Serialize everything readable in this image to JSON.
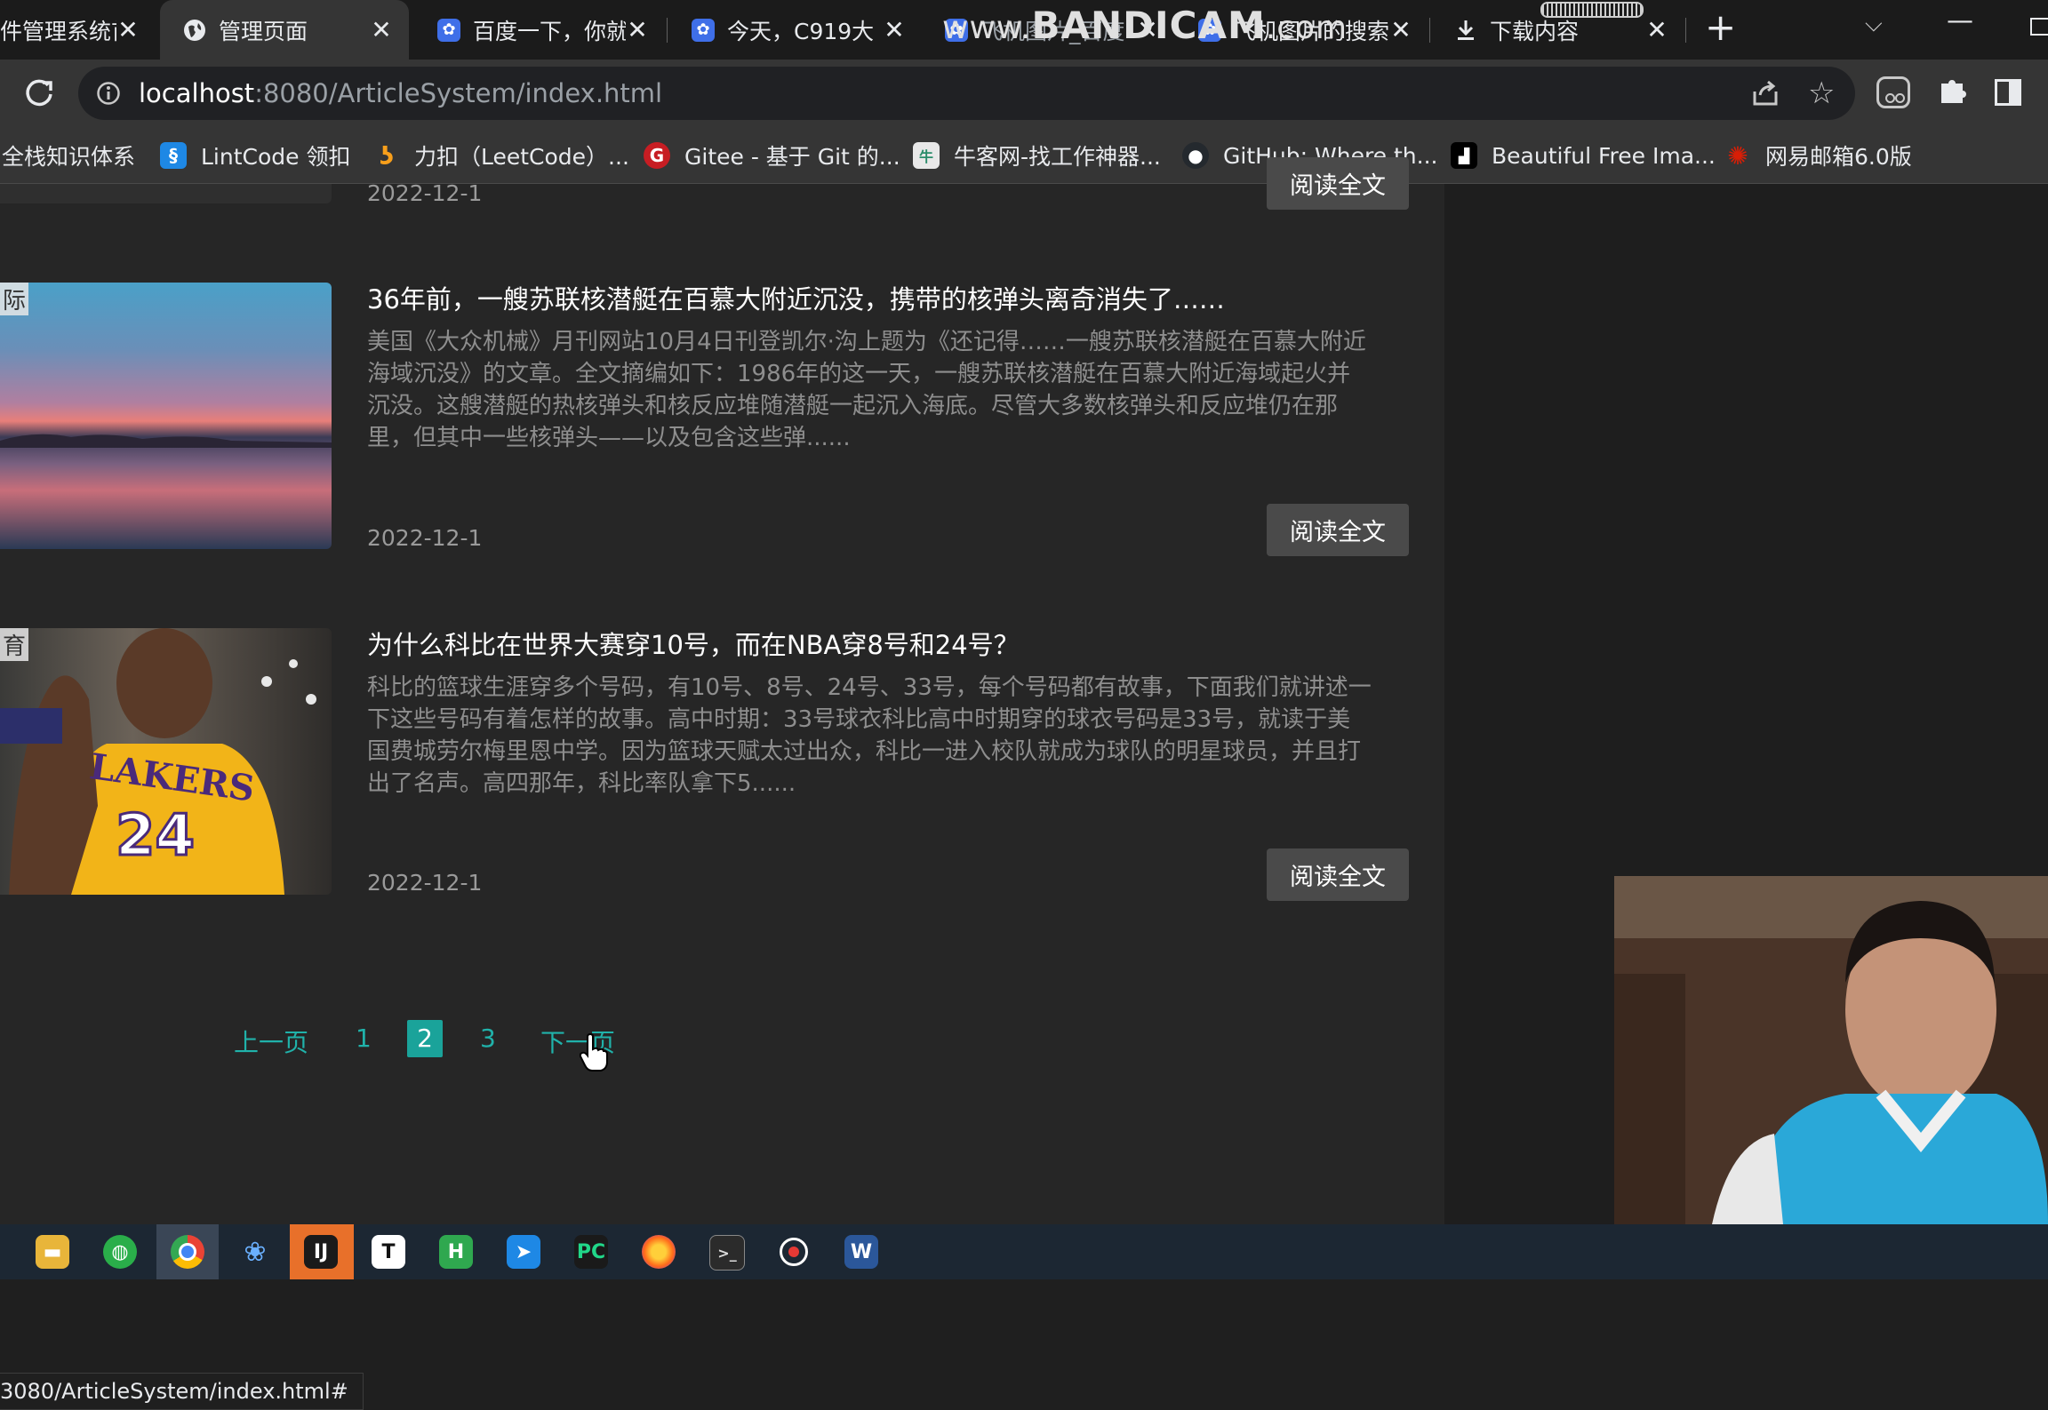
{
  "browser": {
    "tabs": [
      {
        "title": "件管理系统首",
        "favicon": "page-icon"
      },
      {
        "title": "管理页面",
        "favicon": "globe-icon"
      },
      {
        "title": "百度一下，你就",
        "favicon": "baidu-paw-icon"
      },
      {
        "title": "今天，C919大",
        "favicon": "baidu-paw-icon"
      },
      {
        "title": "飞机图片_百度",
        "favicon": "baidu-paw-icon"
      },
      {
        "title": "飞机图片的搜索",
        "favicon": "baidu-paw-icon"
      },
      {
        "title": "下载内容",
        "favicon": "download-icon"
      }
    ],
    "new_tab_label": "+",
    "url_host": "localhost",
    "url_rest": ":8080/ArticleSystem/index.html",
    "bookmarks": [
      {
        "label": "全栈知识体系",
        "icon": "bookmark-icon",
        "color": "#4a4a4a"
      },
      {
        "label": "LintCode 领扣",
        "icon": "lintcode-icon",
        "color": "#1e88e5"
      },
      {
        "label": "力扣（LeetCode）...",
        "icon": "leetcode-icon",
        "color": "#f89f1b"
      },
      {
        "label": "Gitee - 基于 Git 的...",
        "icon": "gitee-icon",
        "color": "#c71d23"
      },
      {
        "label": "牛客网-找工作神器...",
        "icon": "nowcoder-icon",
        "color": "#e8e8e8"
      },
      {
        "label": "GitHub: Where th...",
        "icon": "github-icon",
        "color": "#24292e"
      },
      {
        "label": "Beautiful Free Ima...",
        "icon": "unsplash-icon",
        "color": "#111111"
      },
      {
        "label": "网易邮箱6.0版",
        "icon": "netease-mail-icon",
        "color": "#d81e06"
      }
    ]
  },
  "watermark": {
    "brand": "BANDICAM",
    "prefix": "www.",
    "suffix": ".com"
  },
  "articles": [
    {
      "date": "2022-12-1",
      "button": "阅读全文"
    },
    {
      "category": "际",
      "title": "36年前，一艘苏联核潜艇在百慕大附近沉没，携带的核弹头离奇消失了……",
      "summary": "美国《大众机械》月刊网站10月4日刊登凯尔·沟上题为《还记得……一艘苏联核潜艇在百慕大附近海域沉没》的文章。全文摘编如下：1986年的这一天，一艘苏联核潜艇在百慕大附近海域起火并沉没。这艘潜艇的热核弹头和核反应堆随潜艇一起沉入海底。尽管大多数核弹头和反应堆仍在那里，但其中一些核弹头——以及包含这些弹......",
      "date": "2022-12-1",
      "button": "阅读全文"
    },
    {
      "category": "育",
      "title": "为什么科比在世界大赛穿10号，而在NBA穿8号和24号？",
      "summary": "科比的篮球生涯穿多个号码，有10号、8号、24号、33号，每个号码都有故事，下面我们就讲述一下这些号码有着怎样的故事。高中时期：33号球衣科比高中时期穿的球衣号码是33号，就读于美国费城劳尔梅里恩中学。因为篮球天赋太过出众，科比一进入校队就成为球队的明星球员，并且打出了名声。高四那年，科比率队拿下5......",
      "date": "2022-12-1",
      "button": "阅读全文"
    }
  ],
  "pagination": {
    "prev": "上一页",
    "pages": [
      "1",
      "2",
      "3"
    ],
    "current": "2",
    "next": "下一页"
  },
  "status_url": "3080/ArticleSystem/index.html#"
}
